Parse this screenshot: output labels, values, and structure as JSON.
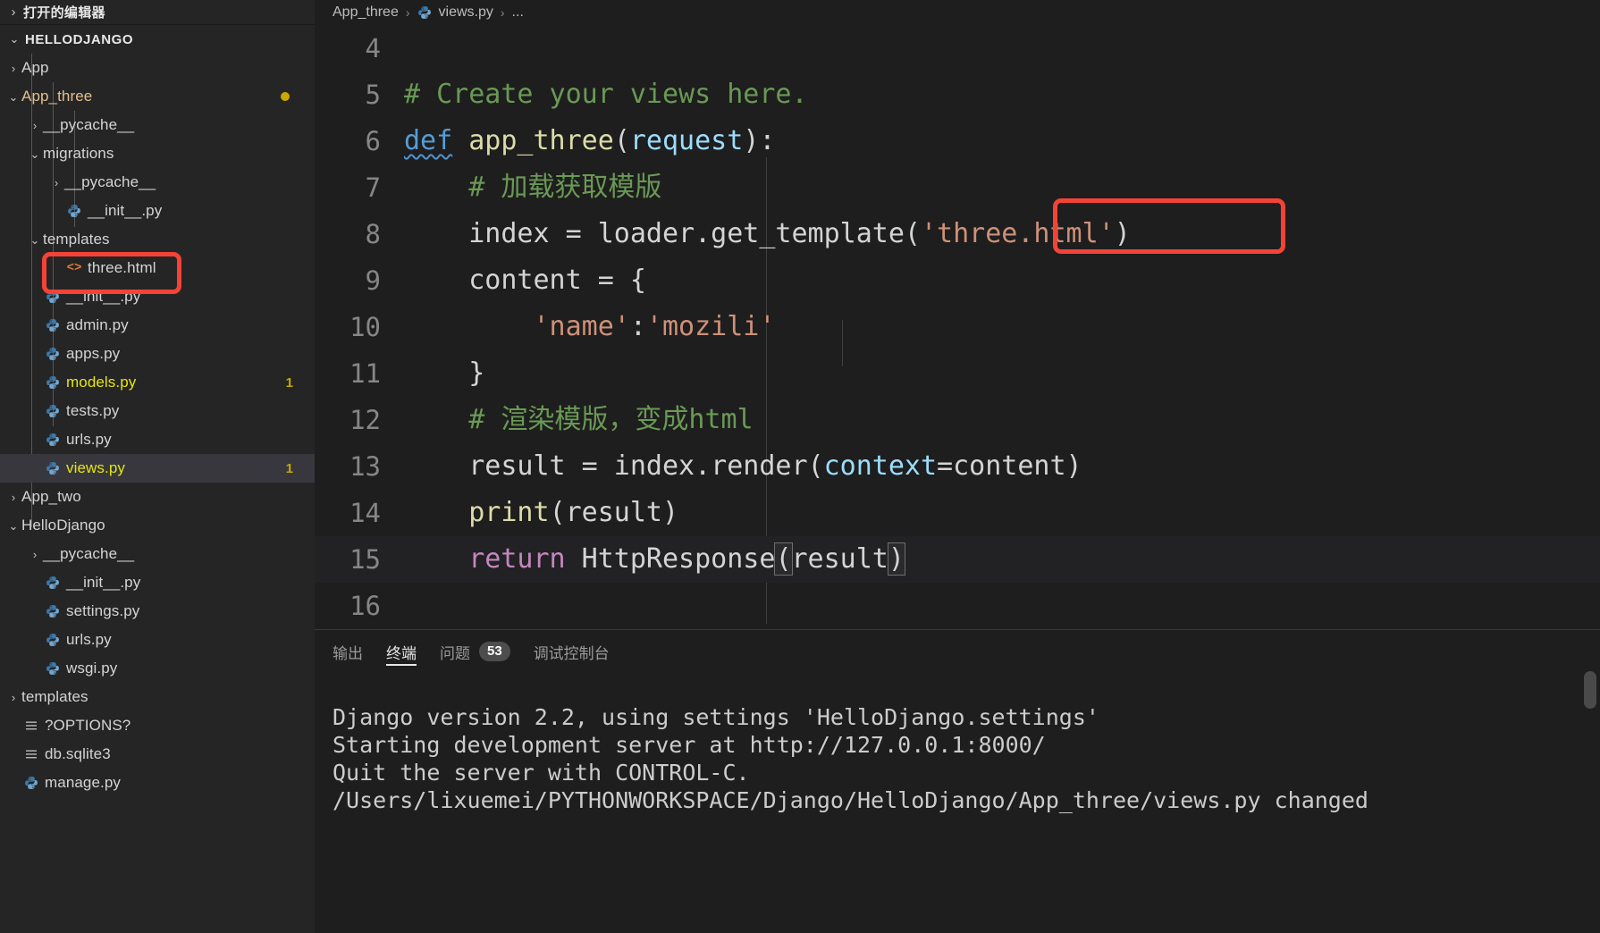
{
  "sidebar": {
    "open_editors_label": "打开的编辑器",
    "root_label": "HELLODJANGO",
    "items": [
      {
        "label": "App",
        "indent": 1,
        "type": "folder",
        "state": "collapsed"
      },
      {
        "label": "App_three",
        "indent": 1,
        "type": "folder",
        "state": "expanded",
        "modified": true,
        "badge_dot": true
      },
      {
        "label": "__pycache__",
        "indent": 2,
        "type": "folder",
        "state": "collapsed"
      },
      {
        "label": "migrations",
        "indent": 2,
        "type": "folder",
        "state": "expanded"
      },
      {
        "label": "__pycache__",
        "indent": 3,
        "type": "folder",
        "state": "collapsed"
      },
      {
        "label": "__init__.py",
        "indent": 3,
        "type": "python"
      },
      {
        "label": "templates",
        "indent": 2,
        "type": "folder",
        "state": "expanded"
      },
      {
        "label": "three.html",
        "indent": 3,
        "type": "html"
      },
      {
        "label": "__init__.py",
        "indent": 2,
        "type": "python"
      },
      {
        "label": "admin.py",
        "indent": 2,
        "type": "python"
      },
      {
        "label": "apps.py",
        "indent": 2,
        "type": "python"
      },
      {
        "label": "models.py",
        "indent": 2,
        "type": "python",
        "warn": true,
        "badge_num": "1"
      },
      {
        "label": "tests.py",
        "indent": 2,
        "type": "python"
      },
      {
        "label": "urls.py",
        "indent": 2,
        "type": "python"
      },
      {
        "label": "views.py",
        "indent": 2,
        "type": "python",
        "warn": true,
        "badge_num": "1",
        "selected": true
      },
      {
        "label": "App_two",
        "indent": 1,
        "type": "folder",
        "state": "collapsed"
      },
      {
        "label": "HelloDjango",
        "indent": 1,
        "type": "folder",
        "state": "expanded"
      },
      {
        "label": "__pycache__",
        "indent": 2,
        "type": "folder",
        "state": "collapsed"
      },
      {
        "label": "__init__.py",
        "indent": 2,
        "type": "python"
      },
      {
        "label": "settings.py",
        "indent": 2,
        "type": "python"
      },
      {
        "label": "urls.py",
        "indent": 2,
        "type": "python"
      },
      {
        "label": "wsgi.py",
        "indent": 2,
        "type": "python"
      },
      {
        "label": "templates",
        "indent": 1,
        "type": "folder",
        "state": "collapsed"
      },
      {
        "label": "?OPTIONS?",
        "indent": 1,
        "type": "file"
      },
      {
        "label": "db.sqlite3",
        "indent": 1,
        "type": "file"
      },
      {
        "label": "manage.py",
        "indent": 1,
        "type": "python"
      }
    ]
  },
  "breadcrumb": {
    "crumb1": "App_three",
    "crumb2": "views.py",
    "crumb3": "...",
    "separator": "›"
  },
  "editor": {
    "lines": [
      {
        "num": "4",
        "tokens": []
      },
      {
        "num": "5",
        "tokens": [
          {
            "t": "# Create your views here.",
            "c": "cmt"
          }
        ]
      },
      {
        "num": "6",
        "tokens": [
          {
            "t": "def",
            "c": "kw squiggle"
          },
          {
            "t": " ",
            "c": "pln"
          },
          {
            "t": "app_three",
            "c": "fn"
          },
          {
            "t": "(",
            "c": "pln"
          },
          {
            "t": "request",
            "c": "par"
          },
          {
            "t": "):",
            "c": "pln"
          }
        ]
      },
      {
        "num": "7",
        "tokens": [
          {
            "t": "    ",
            "c": "pln"
          },
          {
            "t": "# 加载获取模版",
            "c": "cmt"
          }
        ]
      },
      {
        "num": "8",
        "tokens": [
          {
            "t": "    index = loader.get_template(",
            "c": "pln"
          },
          {
            "t": "'three.html'",
            "c": "str"
          },
          {
            "t": ")",
            "c": "pln"
          }
        ]
      },
      {
        "num": "9",
        "tokens": [
          {
            "t": "    content = {",
            "c": "pln"
          }
        ]
      },
      {
        "num": "10",
        "tokens": [
          {
            "t": "        ",
            "c": "pln"
          },
          {
            "t": "'name'",
            "c": "str"
          },
          {
            "t": ":",
            "c": "pln"
          },
          {
            "t": "'mozili'",
            "c": "str"
          }
        ]
      },
      {
        "num": "11",
        "tokens": [
          {
            "t": "    }",
            "c": "pln"
          }
        ]
      },
      {
        "num": "12",
        "tokens": [
          {
            "t": "    ",
            "c": "pln"
          },
          {
            "t": "# 渲染模版，变成html",
            "c": "cmt"
          }
        ]
      },
      {
        "num": "13",
        "tokens": [
          {
            "t": "    result = index.render(",
            "c": "pln"
          },
          {
            "t": "context",
            "c": "par"
          },
          {
            "t": "=content)",
            "c": "pln"
          }
        ]
      },
      {
        "num": "14",
        "tokens": [
          {
            "t": "    ",
            "c": "pln"
          },
          {
            "t": "print",
            "c": "fn"
          },
          {
            "t": "(result)",
            "c": "pln"
          }
        ]
      },
      {
        "num": "15",
        "tokens": [
          {
            "t": "    ",
            "c": "pln"
          },
          {
            "t": "return",
            "c": "kw2"
          },
          {
            "t": " HttpResponse",
            "c": "pln"
          },
          {
            "t": "(",
            "c": "pln brk"
          },
          {
            "t": "result",
            "c": "pln"
          },
          {
            "t": ")",
            "c": "pln brk"
          }
        ],
        "current": true
      },
      {
        "num": "16",
        "tokens": []
      }
    ]
  },
  "panel": {
    "tabs": [
      {
        "label": "输出",
        "active": false
      },
      {
        "label": "终端",
        "active": true
      },
      {
        "label": "问题",
        "active": false,
        "count": "53"
      },
      {
        "label": "调试控制台",
        "active": false
      }
    ],
    "terminal_lines": [
      "Django version 2.2, using settings 'HelloDjango.settings'",
      "Starting development server at http://127.0.0.1:8000/",
      "Quit the server with CONTROL-C.",
      "/Users/lixuemei/PYTHONWORKSPACE/Django/HelloDjango/App_three/views.py changed"
    ]
  },
  "colors": {
    "accent_red": "#f44336",
    "modified_yellow": "#e2c08d",
    "warn_yellow": "#cca700",
    "selection_bg": "#37373d"
  }
}
